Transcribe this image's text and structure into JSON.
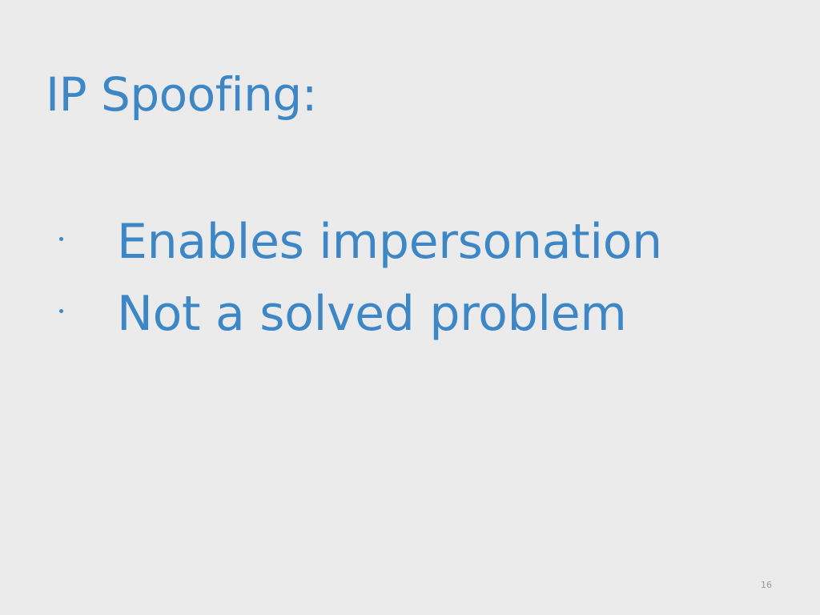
{
  "slide": {
    "title": "IP Spoofing:",
    "bullets": [
      {
        "text": "Enables impersonation"
      },
      {
        "text": "Not a solved problem"
      }
    ],
    "page_number": "16"
  },
  "colors": {
    "background": "#ebebeb",
    "text_accent": "#3d87c7",
    "page_number": "#9a9a9a"
  }
}
